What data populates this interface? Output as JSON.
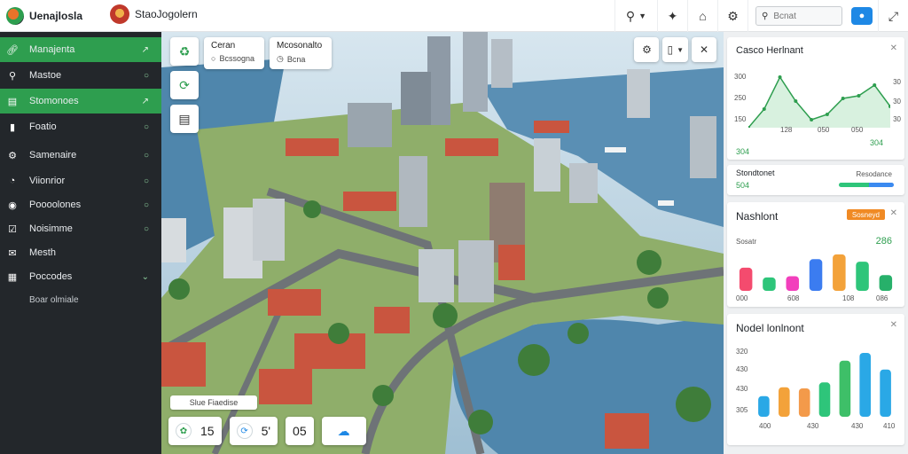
{
  "header": {
    "brand_title": "Uenajlosla",
    "app_title": "StaoJogolern",
    "search_placeholder": "Bcnat"
  },
  "sidebar": {
    "items": [
      {
        "label": "Manajenta",
        "icon": "link-icon",
        "active": true,
        "trail": "↗"
      },
      {
        "label": "Mastoe",
        "icon": "search-icon",
        "active": false,
        "trail": "○"
      },
      {
        "label": "Stomonoes",
        "icon": "list-icon",
        "active": true,
        "trail": "↗"
      },
      {
        "label": "Foatio",
        "icon": "bookmark-icon",
        "active": false,
        "trail": "○"
      },
      {
        "label": "Samenaire",
        "icon": "gear-icon",
        "active": false,
        "trail": "○"
      },
      {
        "label": "Viionrior",
        "icon": "gauge-icon",
        "active": false,
        "trail": "○"
      },
      {
        "label": "Poooolones",
        "icon": "pin-icon",
        "active": false,
        "trail": "○"
      },
      {
        "label": "Noisimme",
        "icon": "check-icon",
        "active": false,
        "trail": "○"
      },
      {
        "label": "Mesth",
        "icon": "mail-icon",
        "active": false,
        "trail": ""
      },
      {
        "label": "Poccodes",
        "icon": "folder-icon",
        "active": false,
        "trail": "⌄"
      }
    ],
    "footer": "Boar olmiale"
  },
  "map": {
    "card1": {
      "title": "Ceran",
      "sub": "Bcssogna"
    },
    "card2": {
      "title": "Mcosonalto",
      "sub": "Bcna"
    },
    "caption": "Slue Fiaedise",
    "stats": [
      {
        "value": "15",
        "icon": "leaf-icon"
      },
      {
        "value": "5'",
        "icon": "route-icon"
      },
      {
        "value": "05",
        "icon": ""
      },
      {
        "value": "",
        "icon": "cloud-icon"
      }
    ]
  },
  "panel": {
    "card1": {
      "title": "Casco Herlnant",
      "y_ticks": [
        "300",
        "250",
        "150"
      ],
      "x_ticks": [
        "128",
        "050",
        "050"
      ],
      "right_ticks": [
        "30",
        "30",
        "30"
      ],
      "foot_left": "304",
      "foot_right": "304"
    },
    "card2": {
      "title": "Stondtonet",
      "value": "504",
      "right_label": "Resodance"
    },
    "card3": {
      "title": "Nashlont",
      "badge": "Sosneyd",
      "legend_left": "Sosatr",
      "legend_right": "286",
      "x_ticks": [
        "000",
        "608",
        "108",
        "086"
      ]
    },
    "card4": {
      "title": "Nodel lonlnont",
      "y_ticks": [
        "320",
        "430",
        "430",
        "305"
      ],
      "x_ticks": [
        "400",
        "430",
        "430",
        "410"
      ]
    }
  },
  "colors": {
    "accent": "#2e9e4f",
    "sidebar": "#23272b",
    "water": "#4f86ac",
    "roof": "#c9553f"
  },
  "chart_data": [
    {
      "type": "area",
      "title": "Casco Herlnant",
      "x": [
        0,
        1,
        2,
        3,
        4,
        5,
        6,
        7,
        8,
        9
      ],
      "values": [
        0,
        35,
        95,
        50,
        15,
        25,
        55,
        60,
        80,
        40
      ],
      "ylim": [
        0,
        100
      ]
    },
    {
      "type": "bar",
      "title": "Nashlont",
      "categories": [
        "1",
        "2",
        "3",
        "4",
        "5",
        "6",
        "7"
      ],
      "values": [
        38,
        22,
        24,
        52,
        60,
        48,
        26
      ],
      "colors": [
        "#f44b6e",
        "#2ec57a",
        "#f23fbc",
        "#3b7cf0",
        "#f3a23a",
        "#2ec57a",
        "#27b06a"
      ],
      "ylim": [
        0,
        70
      ]
    },
    {
      "type": "bar",
      "title": "Nodel lonlnont",
      "categories": [
        "1",
        "2",
        "3",
        "4",
        "5",
        "6",
        "7"
      ],
      "values": [
        35,
        50,
        48,
        58,
        95,
        108,
        80
      ],
      "colors": [
        "#2aa8e6",
        "#f3a23a",
        "#f39a4a",
        "#2ec57a",
        "#3ebf68",
        "#2aa8e6",
        "#2aa8e6"
      ],
      "ylim": [
        0,
        120
      ]
    }
  ]
}
